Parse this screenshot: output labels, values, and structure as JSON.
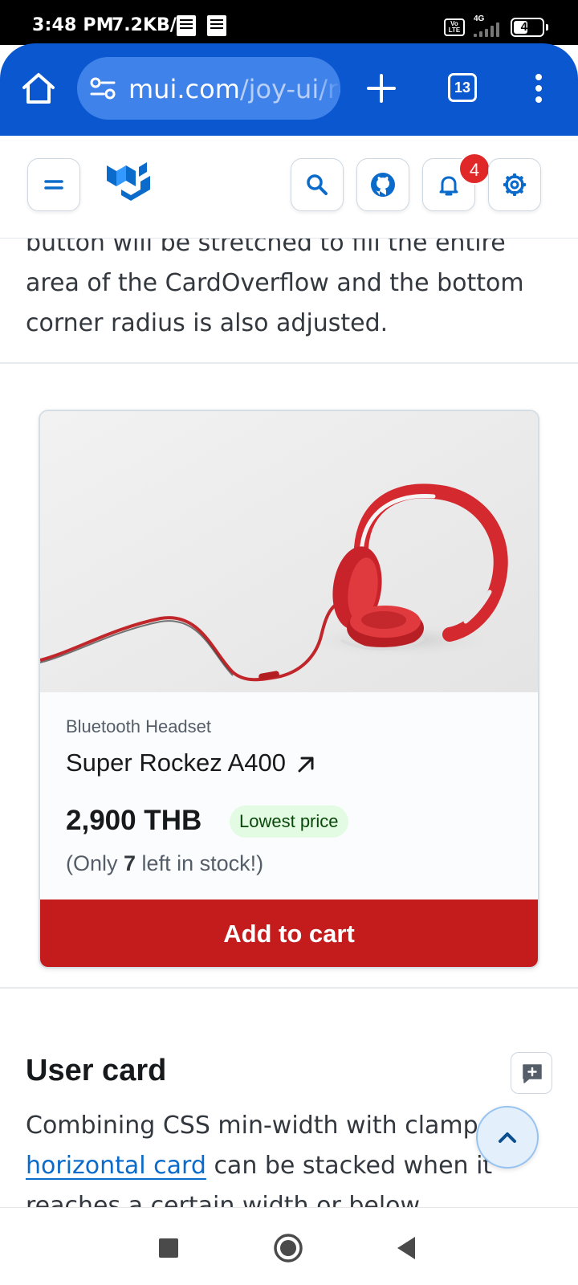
{
  "status_bar": {
    "time": "3:48 PM",
    "net_speed": "7.2KB/s",
    "volte": "Vo LTE",
    "network_type": "4G",
    "battery": "46"
  },
  "browser": {
    "url_host": "mui.com",
    "url_path": "/joy-ui/re",
    "tab_count": "13",
    "accent_color": "#0b57d0"
  },
  "site_header": {
    "notification_count": "4"
  },
  "content": {
    "intro_text": "button will be stretched to fill the entire area of the CardOverflow and the bottom corner radius is also adjusted.",
    "card": {
      "subtitle": "Bluetooth Headset",
      "title": "Super Rockez A400",
      "price": "2,900 THB",
      "price_chip": "Lowest price",
      "stock_prefix": "(Only ",
      "stock_count": "7",
      "stock_suffix": " left in stock!)",
      "cta_label": "Add to cart",
      "cta_color": "#c41c1c"
    },
    "user_card": {
      "title": "User card",
      "text_before": "Combining CSS min-width with clamp, a ",
      "link_text": "horizontal card",
      "text_after": " can be stacked when it reaches a certain width or below."
    }
  }
}
